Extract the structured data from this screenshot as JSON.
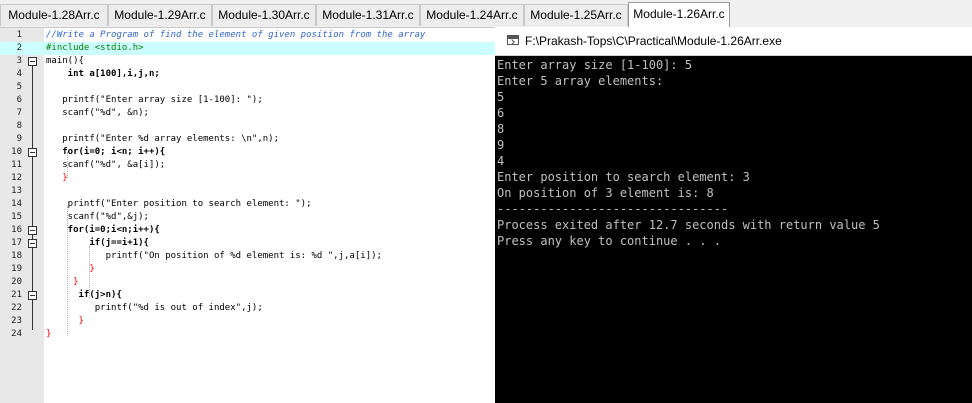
{
  "tabs": [
    "Module-1.28Arr.c",
    "Module-1.29Arr.c",
    "Module-1.30Arr.c",
    "Module-1.31Arr.c",
    "Module-1.24Arr.c",
    "Module-1.25Arr.c",
    "Module-1.26Arr.c"
  ],
  "active_tab": "Module-1.26Arr.c",
  "editor": {
    "line_numbers": [
      "1",
      "2",
      "3",
      "4",
      "5",
      "6",
      "7",
      "8",
      "9",
      "10",
      "11",
      "12",
      "13",
      "14",
      "15",
      "16",
      "17",
      "18",
      "19",
      "20",
      "21",
      "22",
      "23",
      "24"
    ],
    "lines": [
      "//Write a Program of find the element of given position from the array",
      "#include <stdio.h>",
      "main(){",
      "    int a[100],i,j,n;",
      "",
      "   printf(\"Enter array size [1-100]: \");",
      "   scanf(\"%d\", &n);",
      "",
      "   printf(\"Enter %d array elements: \\n\",n);",
      "   for(i=0; i<n; i++){",
      "   scanf(\"%d\", &a[i]);",
      "   }",
      "",
      "    printf(\"Enter position to search element: \");",
      "    scanf(\"%d\",&j);",
      "    for(i=0;i<n;i++){",
      "        if(j==i+1){",
      "           printf(\"On position of %d element is: %d \",j,a[i]);",
      "        }",
      "     }",
      "      if(j>n){",
      "         printf(\"%d is out of index\",j);",
      "      }",
      "}"
    ]
  },
  "console": {
    "title": "F:\\Prakash-Tops\\C\\Practical\\Module-1.26Arr.exe",
    "lines": [
      "Enter array size [1-100]: 5",
      "Enter 5 array elements:",
      "5",
      "6",
      "8",
      "9",
      "4",
      "Enter position to search element: 3",
      "On position of 3 element is: 8",
      "--------------------------------",
      "Process exited after 12.7 seconds with return value 5",
      "Press any key to continue . . ."
    ]
  }
}
